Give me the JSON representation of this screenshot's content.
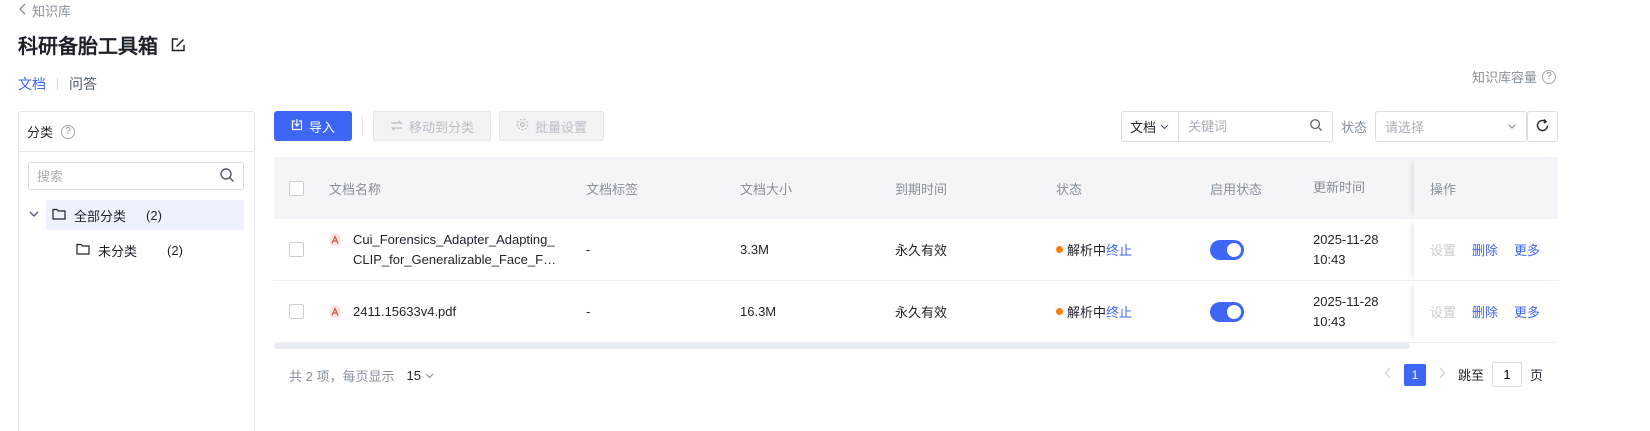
{
  "header": {
    "back_label": "知识库",
    "title": "科研备胎工具箱",
    "capacity_label": "知识库容量"
  },
  "tabs": [
    {
      "label": "文档",
      "active": true
    },
    {
      "label": "问答",
      "active": false
    }
  ],
  "category_panel": {
    "title": "分类",
    "search_placeholder": "搜索",
    "root": {
      "label": "全部分类",
      "count": "(2)"
    },
    "children": [
      {
        "label": "未分类",
        "count": "(2)"
      }
    ]
  },
  "toolbar": {
    "import_label": "导入",
    "move_label": "移动到分类",
    "batch_label": "批量设置"
  },
  "filter": {
    "type_value": "文档",
    "keyword_placeholder": "关键词",
    "status_label": "状态",
    "status_placeholder": "请选择"
  },
  "table": {
    "columns": [
      "文档名称",
      "文档标签",
      "文档大小",
      "到期时间",
      "状态",
      "启用状态",
      "更新时间",
      "操作"
    ],
    "rows": [
      {
        "name_line1": "Cui_Forensics_Adapter_Adapting_",
        "name_line2": "CLIP_for_Generalizable_Face_For...",
        "tag": "-",
        "size": "3.3M",
        "expire": "永久有效",
        "status": "解析中",
        "status_action": "终止",
        "enabled": true,
        "updated_date": "2025-11-28",
        "updated_time": "10:43",
        "ops": {
          "settings": "设置",
          "delete": "删除",
          "more": "更多"
        }
      },
      {
        "name_line1": "2411.15633v4.pdf",
        "name_line2": "",
        "tag": "-",
        "size": "16.3M",
        "expire": "永久有效",
        "status": "解析中",
        "status_action": "终止",
        "enabled": true,
        "updated_date": "2025-11-28",
        "updated_time": "10:43",
        "ops": {
          "settings": "设置",
          "delete": "删除",
          "more": "更多"
        }
      }
    ]
  },
  "pagination": {
    "total_text": "共 2 项，每页显示",
    "page_size": "15",
    "current_page": "1",
    "jump_label": "跳至",
    "jump_value": "1",
    "page_suffix": "页"
  },
  "colors": {
    "accent": "#3e66f5",
    "status_dot": "#ff7d00"
  }
}
